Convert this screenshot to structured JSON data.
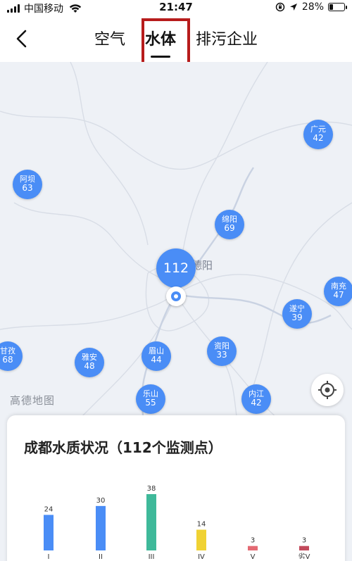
{
  "status_bar": {
    "carrier": "中国移动",
    "time": "21:47",
    "battery": "28%",
    "battery_level": 0.28
  },
  "nav": {
    "tabs": [
      {
        "label": "空气",
        "active": false
      },
      {
        "label": "水体",
        "active": true
      },
      {
        "label": "排污企业",
        "active": false
      }
    ]
  },
  "map": {
    "watermark": "高德地图",
    "city_label": "德阳",
    "main_cluster": "112",
    "markers": [
      {
        "name": "广元",
        "value": "42"
      },
      {
        "name": "阿坝",
        "value": "63"
      },
      {
        "name": "绵阳",
        "value": "69"
      },
      {
        "name": "南充",
        "value": "47"
      },
      {
        "name": "遂宁",
        "value": "39"
      },
      {
        "name": "甘孜",
        "value": "68"
      },
      {
        "name": "雅安",
        "value": "48"
      },
      {
        "name": "眉山",
        "value": "44"
      },
      {
        "name": "资阳",
        "value": "33"
      },
      {
        "name": "乐山",
        "value": "55"
      },
      {
        "name": "内江",
        "value": "42"
      }
    ]
  },
  "card": {
    "title": "成都水质状况（112个监测点）"
  },
  "chart_data": {
    "type": "bar",
    "title": "成都水质状况（112个监测点）",
    "categories": [
      "I",
      "II",
      "III",
      "IV",
      "V",
      "劣V"
    ],
    "values": [
      24,
      30,
      38,
      14,
      3,
      3
    ],
    "colors": [
      "#4a8df6",
      "#4a8df6",
      "#3fb99a",
      "#f0d233",
      "#e46a73",
      "#c24a5b"
    ],
    "ylim": [
      0,
      38
    ],
    "grid": false,
    "legend": "none"
  },
  "colors": {
    "accent": "#4a8df6",
    "highlight_box": "#b71c1c",
    "map_bg": "#eef1f6"
  }
}
